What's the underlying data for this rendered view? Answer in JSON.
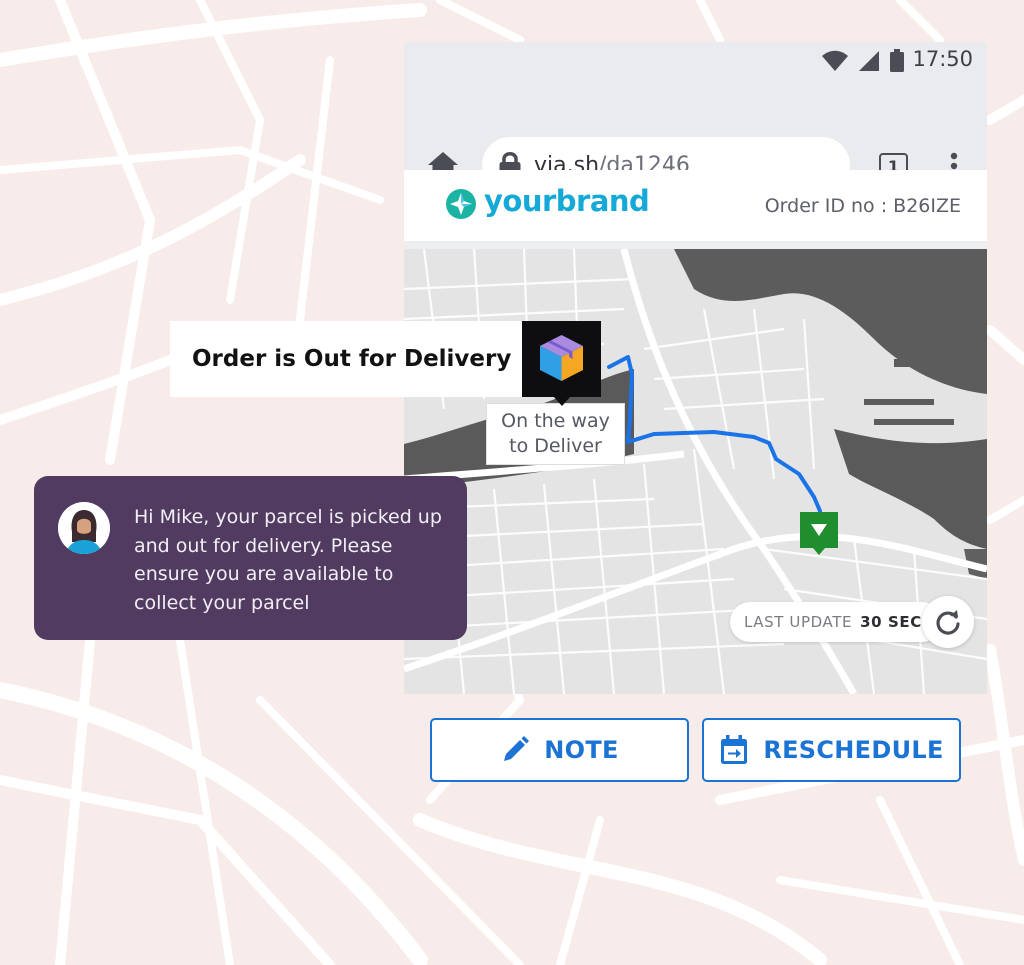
{
  "status_bar": {
    "time": "17:50",
    "icons": [
      "wifi-icon",
      "signal-icon",
      "battery-icon"
    ]
  },
  "browser": {
    "url_host": "via.sh",
    "url_path": "/da1246",
    "tab_count": "1",
    "icons": [
      "home-icon",
      "lock-icon",
      "tabs-icon",
      "more-vert-icon"
    ]
  },
  "header": {
    "brand_name": "yourbrand",
    "order_id": "Order ID no : B26IZE"
  },
  "map": {
    "status_title": "Order is Out for Delivery",
    "route_label_line1": "On the way",
    "route_label_line2": "to Deliver",
    "last_update_label": "LAST UPDATE",
    "last_update_value": "30 SEC",
    "route_color": "#1a73e8",
    "destination_color": "#1e8e2e"
  },
  "message": {
    "text": "Hi Mike, your parcel is picked up and out for delivery. Please ensure you are available to collect your parcel"
  },
  "actions": {
    "note_label": "NOTE",
    "reschedule_label": "RESCHEDULE"
  },
  "colors": {
    "accent": "#1b73d4",
    "brand": "#14a9d6",
    "message_bg": "#513b60",
    "page_bg": "#f7ece9"
  }
}
